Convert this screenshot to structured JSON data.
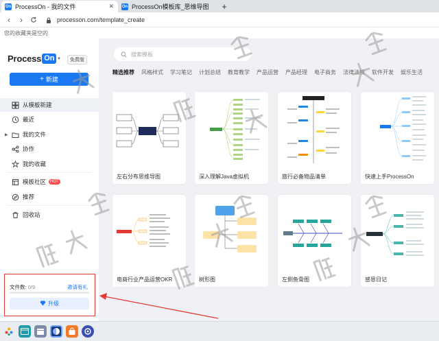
{
  "browser": {
    "tabs": [
      {
        "favicon": "On",
        "title": "ProcessOn - 我的文件"
      },
      {
        "favicon": "On",
        "title": "ProcessOn模板库_思维导图"
      }
    ],
    "new_tab": "+",
    "url": "processon.com/template_create",
    "bookmarks_text": "您的收藏夹是空的"
  },
  "sidebar": {
    "logo_process": "Process",
    "logo_on": "On",
    "plan_badge": "免费版",
    "new_button": "新建",
    "nav": [
      {
        "label": "从模板新建",
        "icon": "template-icon"
      },
      {
        "label": "最近",
        "icon": "clock-icon"
      },
      {
        "label": "我的文件",
        "icon": "folder-icon"
      },
      {
        "label": "协作",
        "icon": "share-icon"
      },
      {
        "label": "我的收藏",
        "icon": "star-icon"
      },
      {
        "label": "模板社区",
        "icon": "community-icon",
        "badge": "HOT"
      },
      {
        "label": "推荐",
        "icon": "compass-icon"
      },
      {
        "label": "回收站",
        "icon": "trash-icon"
      }
    ],
    "storage": {
      "label": "文件数:",
      "count": "0/9",
      "invite": "邀请有礼",
      "used_fraction": 0,
      "upgrade": "升级"
    }
  },
  "main": {
    "search_placeholder": "搜索模板",
    "categories": [
      "精选推荐",
      "风格样式",
      "学习笔记",
      "计划总结",
      "教育教学",
      "产品运营",
      "产品经理",
      "电子商务",
      "法律法规",
      "软件开发",
      "娱乐生活"
    ],
    "templates": [
      {
        "title": "左右分布思维导图"
      },
      {
        "title": "深入理解Java虚拟机"
      },
      {
        "title": "旅行必备物品清单"
      },
      {
        "title": "快速上手ProcessOn"
      },
      {
        "title": "电商行业产品运营OKR"
      },
      {
        "title": "树形图"
      },
      {
        "title": "左侧鱼骨图"
      },
      {
        "title": "感恩日记"
      }
    ]
  },
  "colors": {
    "brand": "#1a78f2",
    "annotation": "#e53935",
    "hot": "#ff4d4f"
  }
}
